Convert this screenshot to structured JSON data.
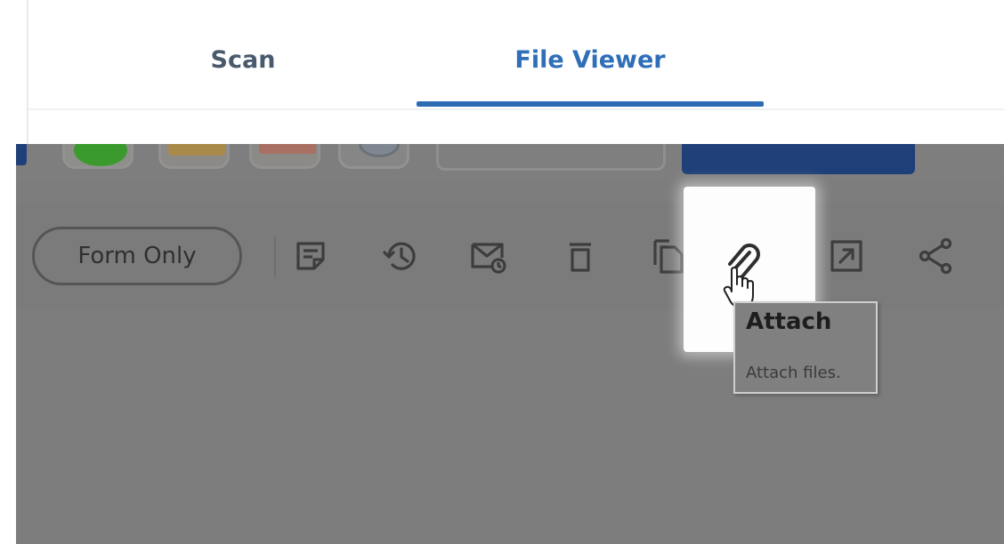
{
  "tabs": [
    {
      "label": "Scan",
      "active": false
    },
    {
      "label": "File Viewer",
      "active": true
    }
  ],
  "actions": {
    "form_only_label": "Form Only",
    "icons": [
      "note-icon",
      "history-icon",
      "mail-icon",
      "trash-icon",
      "copy-icon",
      "attach-icon",
      "expand-icon",
      "share-icon"
    ]
  },
  "tooltip": {
    "title": "Attach",
    "description": "Attach files."
  },
  "colors": {
    "accent": "#2b6cb5",
    "primary_button": "#1f3f79",
    "overlay": "#7d7d7d"
  }
}
